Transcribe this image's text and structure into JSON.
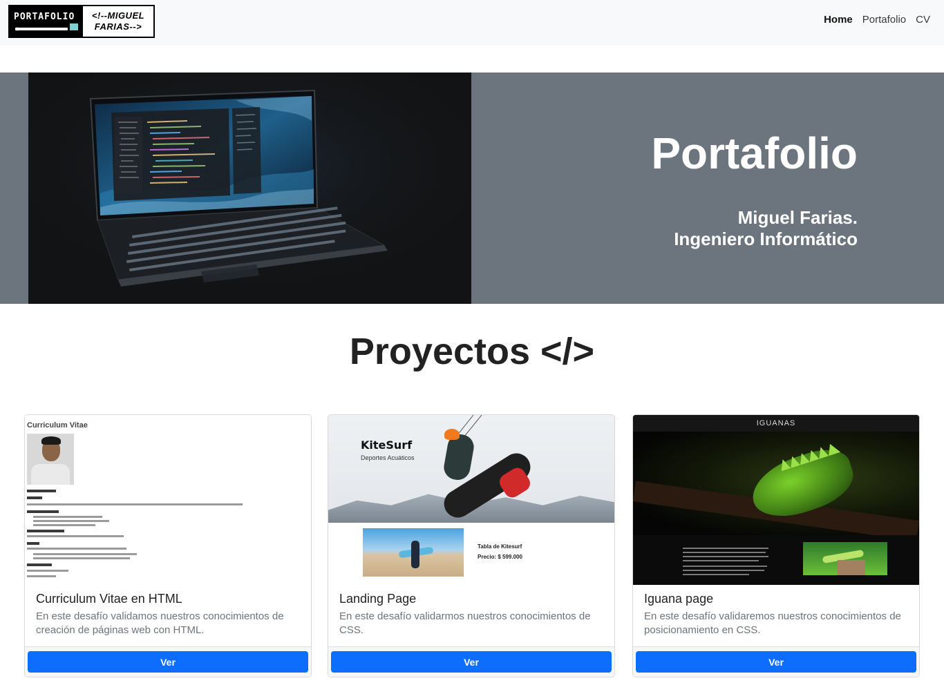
{
  "navbar": {
    "logo_left": "PORTAFOLIO",
    "logo_right_line1": "<!--MIGUEL",
    "logo_right_line2": "FARIAS-->",
    "links": [
      "Home",
      "Portafolio",
      "CV"
    ]
  },
  "hero": {
    "title": "Portafolio",
    "subtitle_line1": "Miguel Farias.",
    "subtitle_line2": "Ingeniero Informático"
  },
  "section": {
    "title": "Proyectos </>"
  },
  "cards": [
    {
      "title": "Curriculum Vitae en HTML",
      "text": "En este desafío validamos nuestros conocimientos de creación de páginas web con HTML.",
      "button": "Ver",
      "thumb_heading": "Curriculum Vitae"
    },
    {
      "title": "Landing Page",
      "text": "En este desafío validarmos nuestros conocimientos de CSS.",
      "button": "Ver",
      "thumb_brand": "KiteSurf",
      "thumb_tagline": "Deportes Acuáticos",
      "thumb_table": "Tabla de Kitesurf",
      "thumb_price": "Precio: $ 599.000"
    },
    {
      "title": "Iguana page",
      "text": "En este desafío validaremos nuestros conocimientos de posicionamiento en CSS.",
      "button": "Ver",
      "thumb_header": "IGUANAS"
    }
  ],
  "colors": {
    "primary": "#0d6efd",
    "hero_bg": "#6c757d",
    "navbar_bg": "#f8f9fa"
  }
}
